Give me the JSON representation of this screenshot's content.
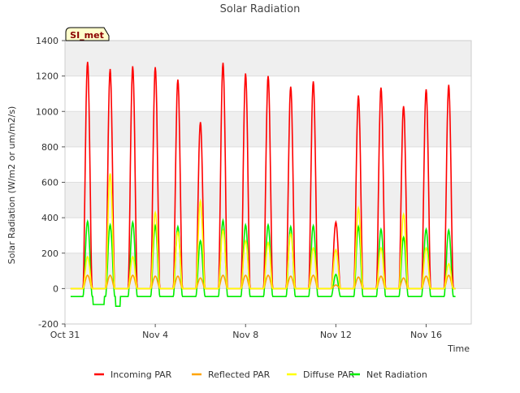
{
  "chart_data": {
    "type": "line",
    "title": "Solar Radiation",
    "xlabel": "Time",
    "ylabel": "Solar Radiation (W/m2 or um/m2/s)",
    "ylim": [
      -200,
      1400
    ],
    "xlim_days": [
      "Oct 31",
      "Nov 18"
    ],
    "yticks": [
      -200,
      0,
      200,
      400,
      600,
      800,
      1000,
      1200,
      1400
    ],
    "xticks": [
      {
        "day": 0,
        "label": "Oct 31"
      },
      {
        "day": 4,
        "label": "Nov 4"
      },
      {
        "day": 8,
        "label": "Nov 8"
      },
      {
        "day": 12,
        "label": "Nov 12"
      },
      {
        "day": 16,
        "label": "Nov 16"
      }
    ],
    "annotation": "SI_met",
    "grid": true,
    "background_bands": true,
    "legend_position": "bottom",
    "series": [
      {
        "name": "Incoming PAR",
        "color": "#ff0000",
        "values": [
          1280,
          1240,
          1255,
          1250,
          1180,
          940,
          1275,
          1215,
          1200,
          1140,
          1170,
          375,
          1090,
          1135,
          1030,
          1125,
          1150
        ]
      },
      {
        "name": "Reflected PAR",
        "color": "#ffa500",
        "values": [
          75,
          75,
          75,
          70,
          70,
          60,
          75,
          75,
          75,
          70,
          75,
          20,
          65,
          70,
          60,
          70,
          75
        ]
      },
      {
        "name": "Diffuse PAR",
        "color": "#ffff00",
        "values": [
          180,
          650,
          180,
          430,
          320,
          495,
          330,
          270,
          260,
          310,
          230,
          220,
          455,
          230,
          420,
          230,
          140
        ]
      },
      {
        "name": "Net Radiation",
        "color": "#00ee00",
        "values": [
          380,
          360,
          375,
          355,
          350,
          270,
          385,
          360,
          360,
          350,
          355,
          80,
          350,
          335,
          290,
          335,
          330
        ],
        "night_min": -100
      }
    ]
  }
}
